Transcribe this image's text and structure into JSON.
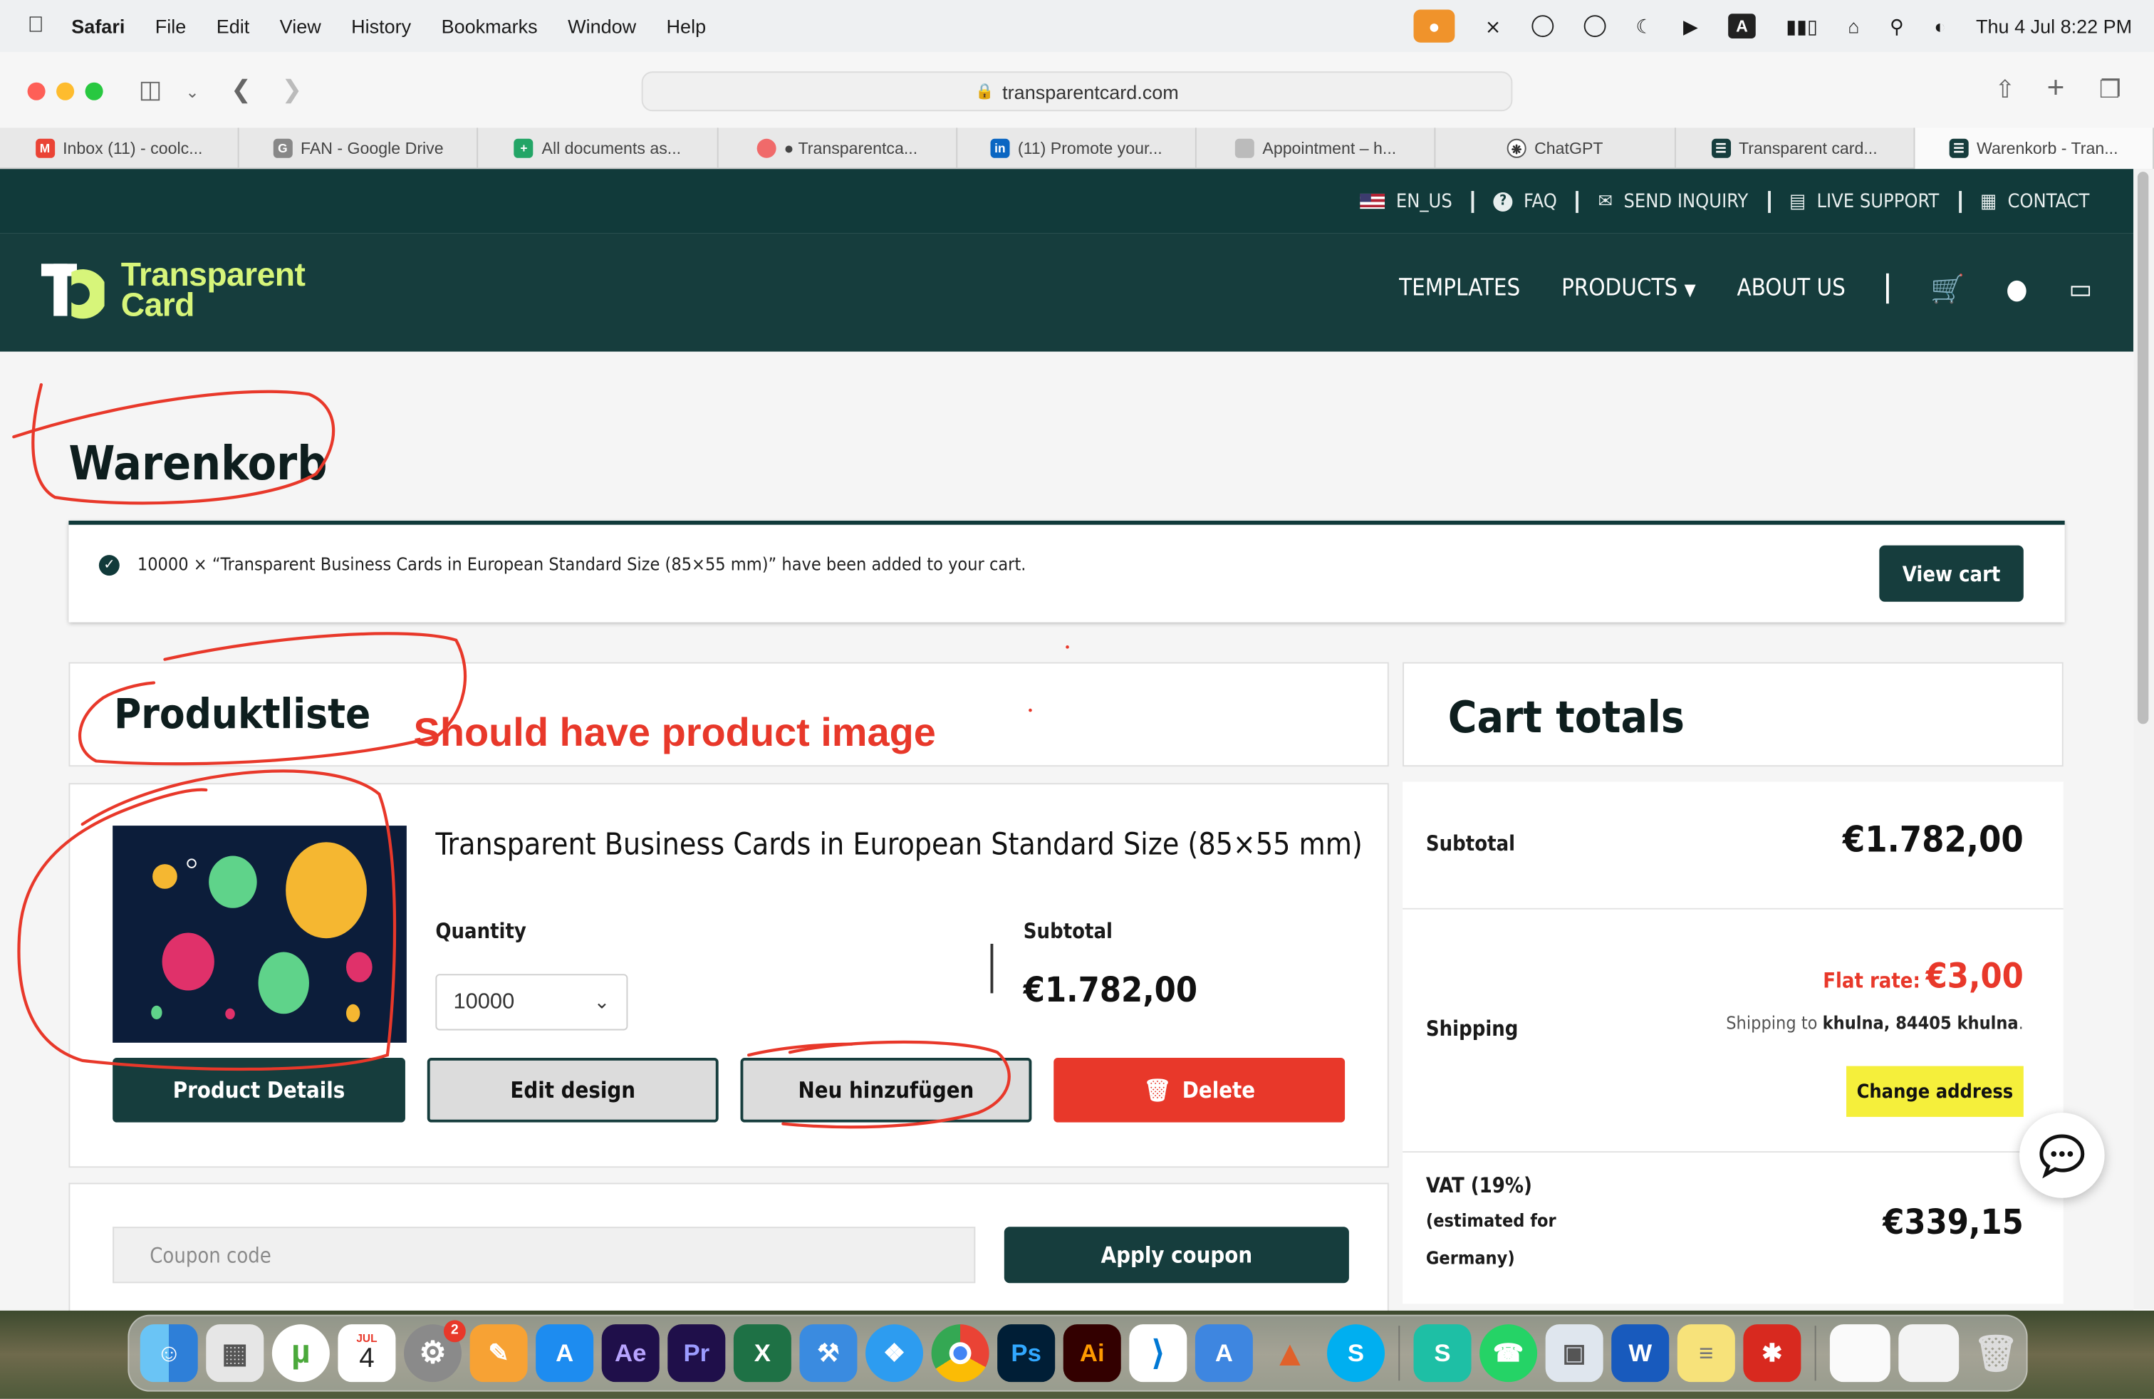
{
  "menubar": {
    "app": "Safari",
    "items": [
      "File",
      "Edit",
      "View",
      "History",
      "Bookmarks",
      "Window",
      "Help"
    ],
    "clock": "Thu 4 Jul  8:22 PM"
  },
  "browser": {
    "url": "transparentcard.com",
    "tabs": [
      {
        "label": "Inbox (11) - coolc...",
        "icon": "gmail-icon"
      },
      {
        "label": "FAN - Google Drive",
        "icon": "google-drive-icon"
      },
      {
        "label": "All documents as...",
        "icon": "sheets-icon"
      },
      {
        "label": "● Transparentca...",
        "icon": "asana-icon"
      },
      {
        "label": "(11) Promote your...",
        "icon": "linkedin-icon"
      },
      {
        "label": "Appointment – h...",
        "icon": "page-icon"
      },
      {
        "label": "ChatGPT",
        "icon": "chatgpt-icon"
      },
      {
        "label": "Transparent card...",
        "icon": "card-icon"
      },
      {
        "label": "Warenkorb - Tran...",
        "icon": "card-icon"
      }
    ]
  },
  "site": {
    "topbar": {
      "lang": "EN_US",
      "faq": "FAQ",
      "inquiry": "SEND INQUIRY",
      "support": "LIVE SUPPORT",
      "contact": "CONTACT"
    },
    "logo": {
      "line1": "Transparent",
      "line2": "Card"
    },
    "nav": {
      "templates": "TEMPLATES",
      "products": "PRODUCTS",
      "about": "ABOUT US"
    },
    "page_title": "Warenkorb",
    "notice": {
      "message": "10000 × “Transparent Business Cards in European Standard Size (85×55 mm)” have been added to your cart.",
      "button": "View cart"
    },
    "product_list": {
      "heading": "Produktliste",
      "item": {
        "title": "Transparent Business Cards in European Standard Size (85×55 mm)",
        "quantity_label": "Quantity",
        "quantity": "10000",
        "subtotal_label": "Subtotal",
        "subtotal": "€1.782,00",
        "buttons": {
          "details": "Product Details",
          "edit": "Edit design",
          "add": "Neu hinzufügen",
          "delete": "Delete"
        }
      },
      "coupon_placeholder": "Coupon code",
      "apply_coupon": "Apply coupon"
    },
    "cart_totals": {
      "heading": "Cart totals",
      "subtotal_label": "Subtotal",
      "subtotal": "€1.782,00",
      "shipping_label": "Shipping",
      "flat_rate_label": "Flat rate:",
      "flat_rate": "€3,00",
      "shipping_to": "Shipping to",
      "shipping_address": "khulna, 84405 khulna",
      "change_address": "Change address",
      "vat_label": "VAT (19%)",
      "vat_note_1": "(estimated for",
      "vat_note_2": "Germany)",
      "vat": "€339,15"
    }
  },
  "annotation": {
    "text": "Should have product image"
  },
  "colors": {
    "brand_dark": "#163d3d",
    "brand_accent": "#d7f57a",
    "danger": "#e8382a",
    "highlight": "#f5ef3b"
  },
  "dock": {
    "calendar_month": "JUL",
    "calendar_day": "4",
    "settings_badge": "2",
    "apps": [
      "finder-icon",
      "launchpad-icon",
      "utorrent-icon",
      "calendar-icon",
      "system-settings-icon",
      "pages-icon",
      "app-store-icon",
      "after-effects-icon",
      "premiere-icon",
      "excel-icon",
      "xcode-icon",
      "safari-icon",
      "chrome-icon",
      "photoshop-icon",
      "illustrator-icon",
      "vscode-icon",
      "simulator-icon",
      "matlab-icon",
      "skype-icon",
      "surfshark-icon",
      "whatsapp-icon",
      "preview-icon",
      "word-icon",
      "notes-icon",
      "acrobat-icon",
      "trash-icon"
    ]
  }
}
